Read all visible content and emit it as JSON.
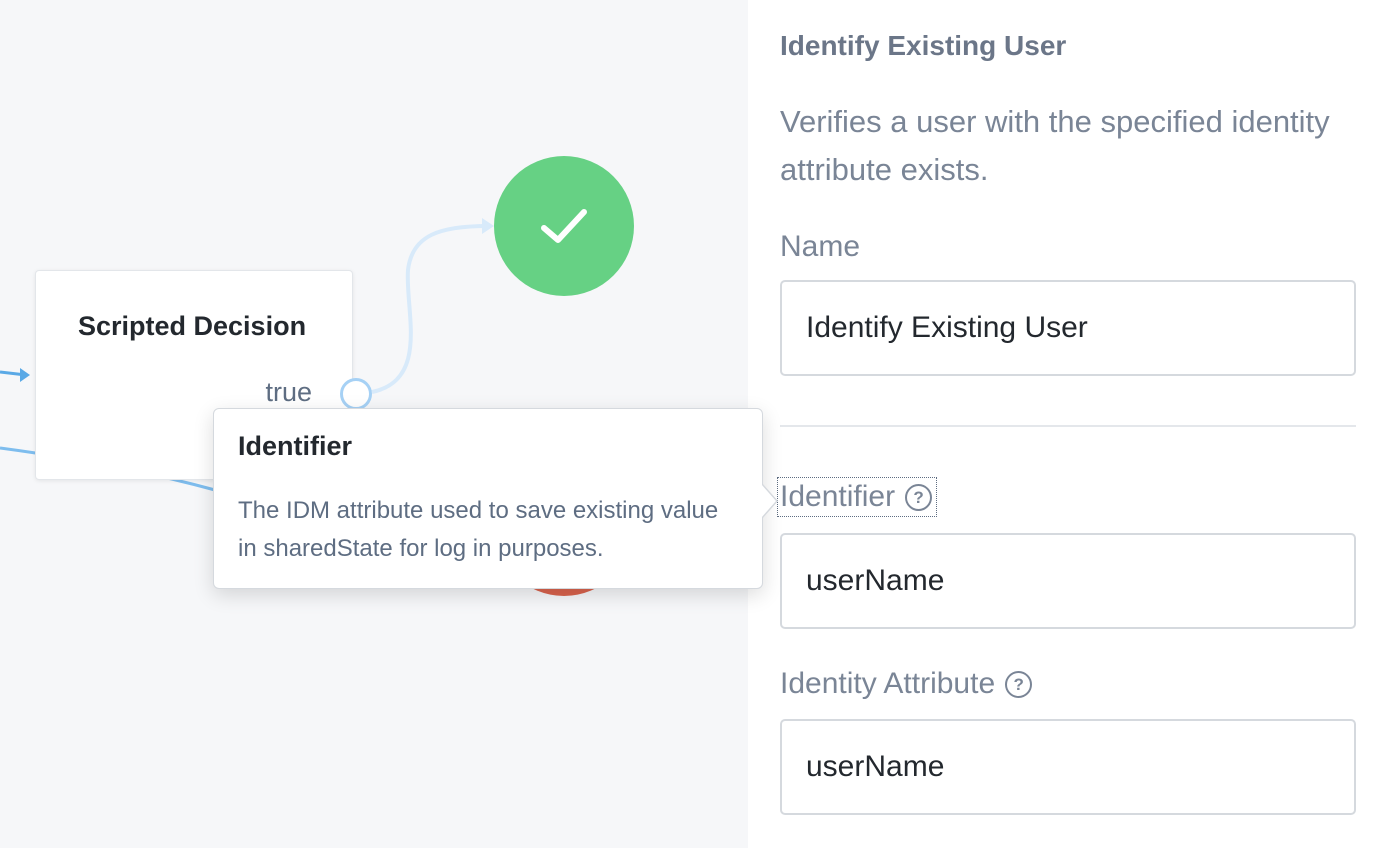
{
  "canvas": {
    "node": {
      "title": "Scripted Decision",
      "outcome_label": "true"
    },
    "success_icon": "checkmark-icon",
    "colors": {
      "success": "#66d184",
      "failure": "#d9634d",
      "connector": "#a6d1f5"
    }
  },
  "tooltip": {
    "title": "Identifier",
    "body": "The IDM attribute used to save existing value in sharedState for log in purposes."
  },
  "panel": {
    "title": "Identify Existing User",
    "description": "Verifies a user with the specified identity attribute exists.",
    "fields": {
      "name": {
        "label": "Name",
        "value": "Identify Existing User"
      },
      "identifier": {
        "label": "Identifier",
        "value": "userName",
        "help_icon": "question-circle-icon"
      },
      "identity_attribute": {
        "label": "Identity Attribute",
        "value": "userName",
        "help_icon": "question-circle-icon"
      }
    }
  }
}
